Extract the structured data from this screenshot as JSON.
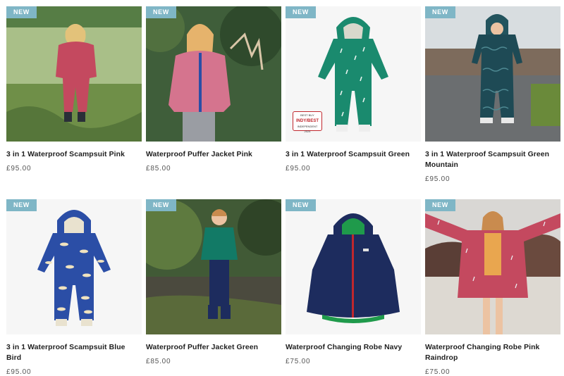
{
  "products": [
    {
      "badge": "NEW",
      "title": "3 in 1 Waterproof Scampsuit Pink",
      "price": "£95.00"
    },
    {
      "badge": "NEW",
      "title": "Waterproof Puffer Jacket Pink",
      "price": "£85.00"
    },
    {
      "badge": "NEW",
      "title": "3 in 1 Waterproof Scampsuit Green",
      "price": "£95.00",
      "award": {
        "line1": "BEST BUY",
        "line2": "INDY/BEST",
        "line3": "INDEPENDENT",
        "line4": "2024"
      }
    },
    {
      "badge": "NEW",
      "title": "3 in 1 Waterproof Scampsuit Green Mountain",
      "price": "£95.00"
    },
    {
      "badge": "NEW",
      "title": "3 in 1 Waterproof Scampsuit Blue Bird",
      "price": "£95.00"
    },
    {
      "badge": "NEW",
      "title": "Waterproof Puffer Jacket Green",
      "price": "£85.00"
    },
    {
      "badge": "NEW",
      "title": "Waterproof Changing Robe Navy",
      "price": "£75.00"
    },
    {
      "badge": "NEW",
      "title": "Waterproof Changing Robe Pink Raindrop",
      "price": "£75.00"
    }
  ],
  "colors": {
    "badge": "#7fb6c6",
    "pink": "#c4495f",
    "green": "#1a8a6e",
    "navy": "#1d2c5e",
    "blue": "#2b4ea6"
  }
}
